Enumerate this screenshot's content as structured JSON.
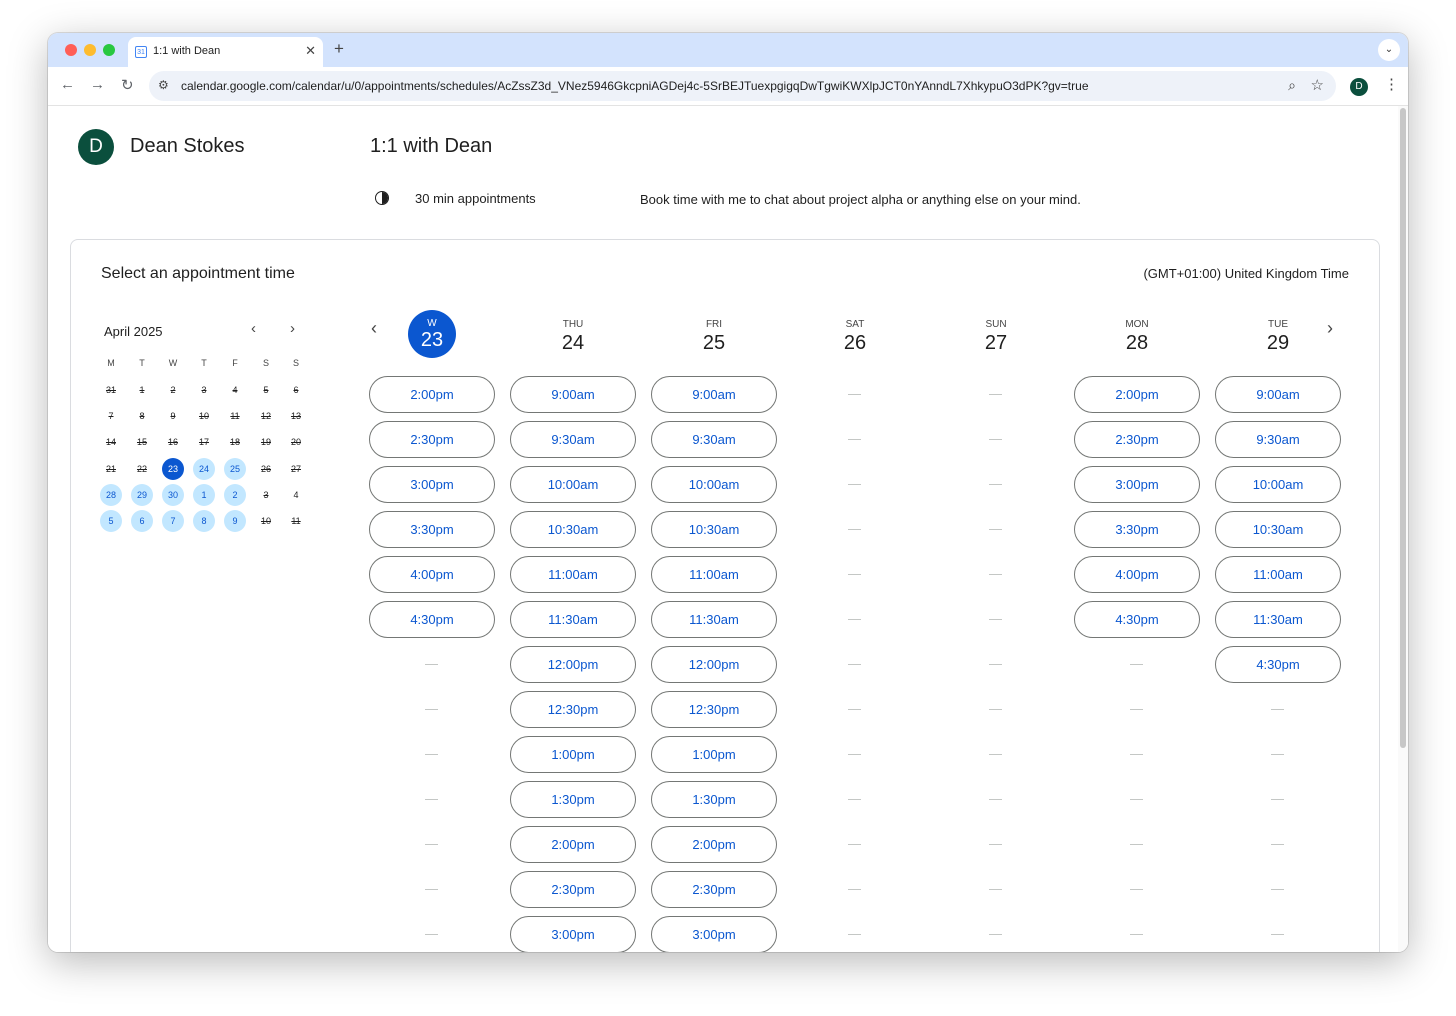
{
  "browser": {
    "tab_title": "1:1 with Dean",
    "tab_favicon": "31",
    "url": "calendar.google.com/calendar/u/0/appointments/schedules/AcZssZ3d_VNez5946GkcpniAGDej4c-5SrBEJTuexpgigqDwTgwiKWXlpJCT0nYAnndL7XhkypuO3dPK?gv=true",
    "profile_initial": "D",
    "icons": [
      "back-icon",
      "forward-icon",
      "reload-icon",
      "tune-icon",
      "zoom-icon",
      "star-icon",
      "kebab-menu-icon",
      "close-icon",
      "plus-icon",
      "chevron-down-icon"
    ]
  },
  "owner": {
    "initial": "D",
    "name": "Dean Stokes",
    "avatar_color": "#0b4f3d"
  },
  "page": {
    "title": "1:1 with Dean",
    "duration": "30 min appointments",
    "description": "Book time with me to chat about project alpha or anything else on your mind."
  },
  "booking": {
    "heading": "Select an appointment time",
    "timezone": "(GMT+01:00) United Kingdom Time"
  },
  "mini_calendar": {
    "month": "April 2025",
    "weekdays": [
      "M",
      "T",
      "W",
      "T",
      "F",
      "S",
      "S"
    ],
    "weeks": [
      [
        {
          "d": "31",
          "s": "past"
        },
        {
          "d": "1",
          "s": "past"
        },
        {
          "d": "2",
          "s": "past"
        },
        {
          "d": "3",
          "s": "past"
        },
        {
          "d": "4",
          "s": "past"
        },
        {
          "d": "5",
          "s": "past"
        },
        {
          "d": "6",
          "s": "past"
        }
      ],
      [
        {
          "d": "7",
          "s": "past"
        },
        {
          "d": "8",
          "s": "past"
        },
        {
          "d": "9",
          "s": "past"
        },
        {
          "d": "10",
          "s": "past"
        },
        {
          "d": "11",
          "s": "past"
        },
        {
          "d": "12",
          "s": "past"
        },
        {
          "d": "13",
          "s": "past"
        }
      ],
      [
        {
          "d": "14",
          "s": "past"
        },
        {
          "d": "15",
          "s": "past"
        },
        {
          "d": "16",
          "s": "past"
        },
        {
          "d": "17",
          "s": "past"
        },
        {
          "d": "18",
          "s": "past"
        },
        {
          "d": "19",
          "s": "past"
        },
        {
          "d": "20",
          "s": "past"
        }
      ],
      [
        {
          "d": "21",
          "s": "past"
        },
        {
          "d": "22",
          "s": "past"
        },
        {
          "d": "23",
          "s": "selected"
        },
        {
          "d": "24",
          "s": "available"
        },
        {
          "d": "25",
          "s": "available"
        },
        {
          "d": "26",
          "s": "past"
        },
        {
          "d": "27",
          "s": "past"
        }
      ],
      [
        {
          "d": "28",
          "s": "available"
        },
        {
          "d": "29",
          "s": "available"
        },
        {
          "d": "30",
          "s": "available"
        },
        {
          "d": "1",
          "s": "available"
        },
        {
          "d": "2",
          "s": "available"
        },
        {
          "d": "3",
          "s": "past"
        },
        {
          "d": "4",
          "s": "normal"
        }
      ],
      [
        {
          "d": "5",
          "s": "available"
        },
        {
          "d": "6",
          "s": "available"
        },
        {
          "d": "7",
          "s": "available"
        },
        {
          "d": "8",
          "s": "available"
        },
        {
          "d": "9",
          "s": "available"
        },
        {
          "d": "10",
          "s": "past"
        },
        {
          "d": "11",
          "s": "past"
        }
      ]
    ]
  },
  "days": [
    {
      "name": "W",
      "num": "23",
      "selected": true,
      "slots": [
        "2:00pm",
        "2:30pm",
        "3:00pm",
        "3:30pm",
        "4:00pm",
        "4:30pm",
        "",
        "",
        "",
        "",
        "",
        "",
        ""
      ]
    },
    {
      "name": "THU",
      "num": "24",
      "selected": false,
      "slots": [
        "9:00am",
        "9:30am",
        "10:00am",
        "10:30am",
        "11:00am",
        "11:30am",
        "12:00pm",
        "12:30pm",
        "1:00pm",
        "1:30pm",
        "2:00pm",
        "2:30pm",
        "3:00pm"
      ]
    },
    {
      "name": "FRI",
      "num": "25",
      "selected": false,
      "slots": [
        "9:00am",
        "9:30am",
        "10:00am",
        "10:30am",
        "11:00am",
        "11:30am",
        "12:00pm",
        "12:30pm",
        "1:00pm",
        "1:30pm",
        "2:00pm",
        "2:30pm",
        "3:00pm"
      ]
    },
    {
      "name": "SAT",
      "num": "26",
      "selected": false,
      "slots": [
        "",
        "",
        "",
        "",
        "",
        "",
        "",
        "",
        "",
        "",
        "",
        "",
        ""
      ]
    },
    {
      "name": "SUN",
      "num": "27",
      "selected": false,
      "slots": [
        "",
        "",
        "",
        "",
        "",
        "",
        "",
        "",
        "",
        "",
        "",
        "",
        ""
      ]
    },
    {
      "name": "MON",
      "num": "28",
      "selected": false,
      "slots": [
        "2:00pm",
        "2:30pm",
        "3:00pm",
        "3:30pm",
        "4:00pm",
        "4:30pm",
        "",
        "",
        "",
        "",
        "",
        "",
        ""
      ]
    },
    {
      "name": "TUE",
      "num": "29",
      "selected": false,
      "slots": [
        "9:00am",
        "9:30am",
        "10:00am",
        "10:30am",
        "11:00am",
        "11:30am",
        "4:30pm",
        "",
        "",
        "",
        "",
        "",
        ""
      ]
    }
  ],
  "colors": {
    "accent": "#0b57d0",
    "available_bg": "#c2e7ff",
    "slot_border": "#747775",
    "tabstrip": "#d3e3fd"
  }
}
